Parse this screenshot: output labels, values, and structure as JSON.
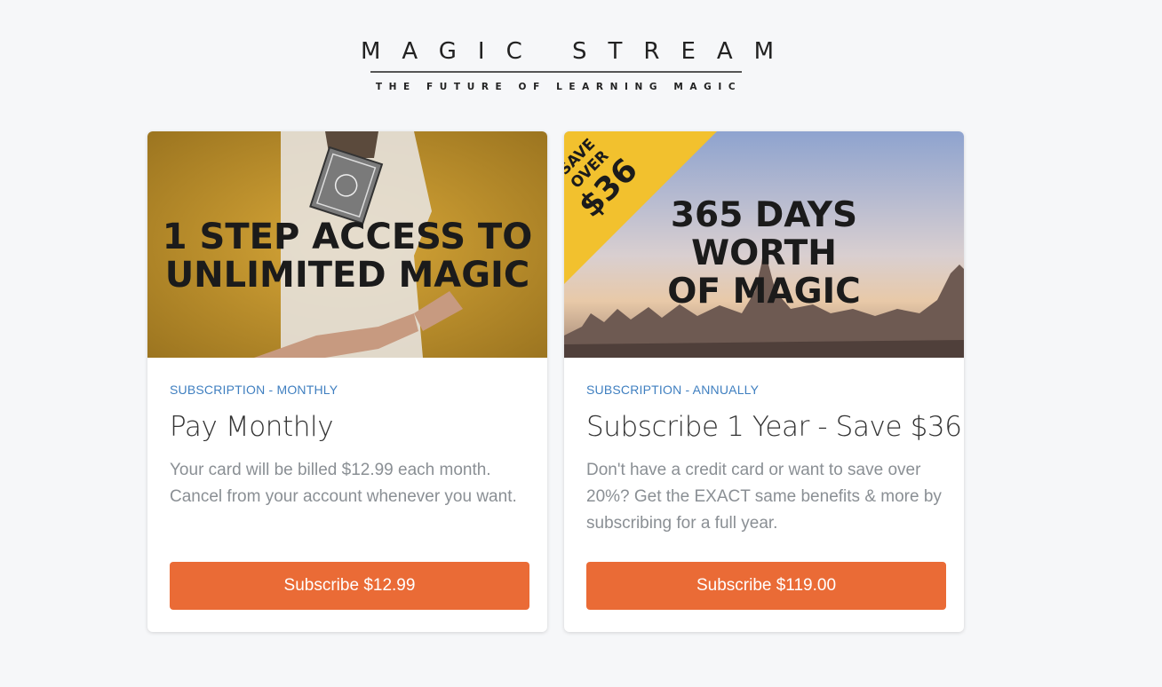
{
  "logo": {
    "title": "MAGIC STREAM",
    "tagline": "THE FUTURE OF LEARNING MAGIC"
  },
  "cards": [
    {
      "banner": {
        "line1": "1 STEP ACCESS TO",
        "line2": "UNLIMITED MAGIC"
      },
      "category": "SUBSCRIPTION - MONTHLY",
      "title": "Pay Monthly",
      "description": "Your card will be billed $12.99 each month. Cancel from your account whenever you want.",
      "button_label": "Subscribe $12.99"
    },
    {
      "banner": {
        "line1": "365 DAYS",
        "line2": "WORTH",
        "line3": "OF MAGIC",
        "badge_line1": "SAVE",
        "badge_line2": "OVER",
        "badge_line3": "$36"
      },
      "category": "SUBSCRIPTION - ANNUALLY",
      "title": "Subscribe 1 Year - Save $36",
      "description": "Don't have a credit card or want to save over 20%? Get the EXACT same benefits & more by subscribing for a full year.",
      "button_label": "Subscribe $119.00"
    }
  ],
  "colors": {
    "accent": "#ea6b36",
    "link": "#3f7fc0",
    "badge": "#f2c12e",
    "background": "#f6f7f9"
  }
}
